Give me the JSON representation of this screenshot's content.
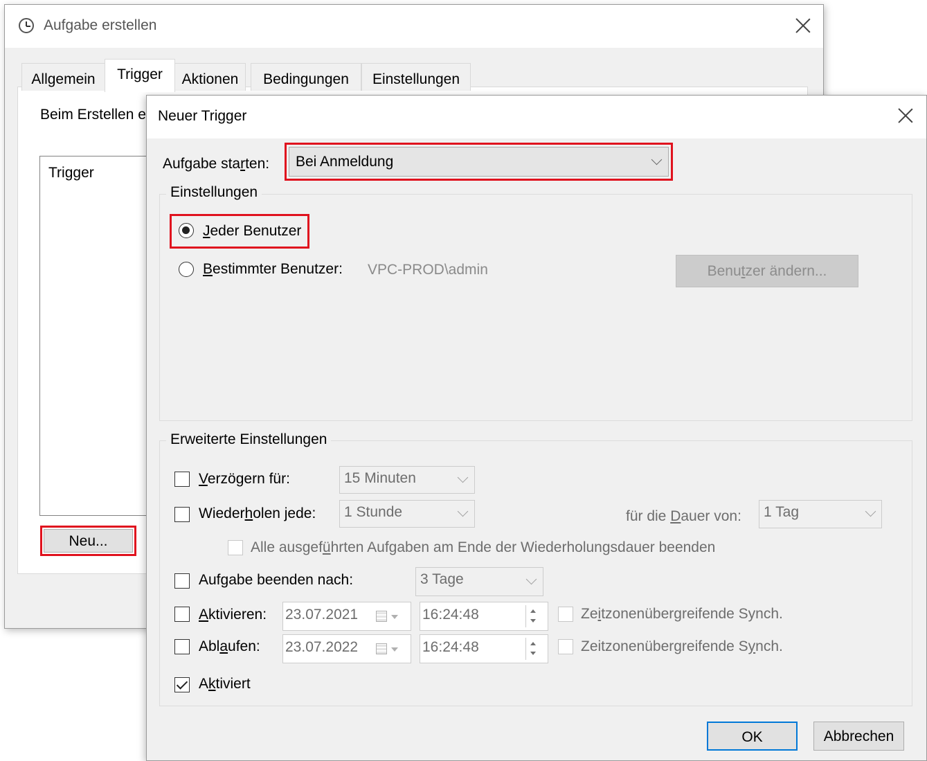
{
  "back_window": {
    "title": "Aufgabe erstellen",
    "tabs": [
      "Allgemein",
      "Trigger",
      "Aktionen",
      "Bedingungen",
      "Einstellungen"
    ],
    "active_tab": "Trigger",
    "description_text": "Beim Erstellen e",
    "list_header": "Trigger",
    "new_button_label": "Neu..."
  },
  "dialog": {
    "title": "Neuer Trigger",
    "start_label_a": "Aufgabe sta",
    "start_label_u": "r",
    "start_label_b": "ten:",
    "start_value": "Bei Anmeldung",
    "settings_group": {
      "title": "Einstellungen",
      "radio_every_user_u": "J",
      "radio_every_user_rest": "eder Benutzer",
      "radio_specific_user_u": "B",
      "radio_specific_user_rest": "estimmter Benutzer:",
      "specific_user_value": "VPC-PROD\\admin",
      "change_user_a": "Benu",
      "change_user_u": "t",
      "change_user_b": "zer ändern..."
    },
    "advanced_group": {
      "title": "Erweiterte Einstellungen",
      "delay_u": "V",
      "delay_rest": "erzögern für:",
      "delay_value": "15 Minuten",
      "repeat_a": "Wieder",
      "repeat_u": "h",
      "repeat_b": "olen jede:",
      "repeat_value": "1 Stunde",
      "duration_a": "für die ",
      "duration_u": "D",
      "duration_b": "auer von:",
      "duration_value": "1 Tag",
      "stop_all_a": "Alle ausgef",
      "stop_all_u": "ü",
      "stop_all_b": "hrten Aufgaben am Ende der Wiederholungsdauer beenden",
      "stop_after_a": "Auf",
      "stop_after_u": "g",
      "stop_after_b": "abe beenden nach:",
      "stop_after_value": "3 Tage",
      "activate_u": "A",
      "activate_rest": "ktivieren:",
      "activate_date": "23.07.2021",
      "activate_time": "16:24:48",
      "sync1_a": "Ze",
      "sync1_u": "i",
      "sync1_b": "tzonenübergreifende Synch.",
      "expire_a": "Abl",
      "expire_u": "a",
      "expire_b": "ufen:",
      "expire_date": "23.07.2022",
      "expire_time": "16:24:48",
      "sync2_a": "Zeitzonenübergreifende S",
      "sync2_u": "y",
      "sync2_b": "nch.",
      "enabled_a": "A",
      "enabled_u": "k",
      "enabled_b": "tiviert"
    },
    "ok_label": "OK",
    "cancel_label": "Abbrechen"
  },
  "accent_colors": {
    "highlight_red": "#e0121e",
    "focus_blue": "#0078d7"
  }
}
